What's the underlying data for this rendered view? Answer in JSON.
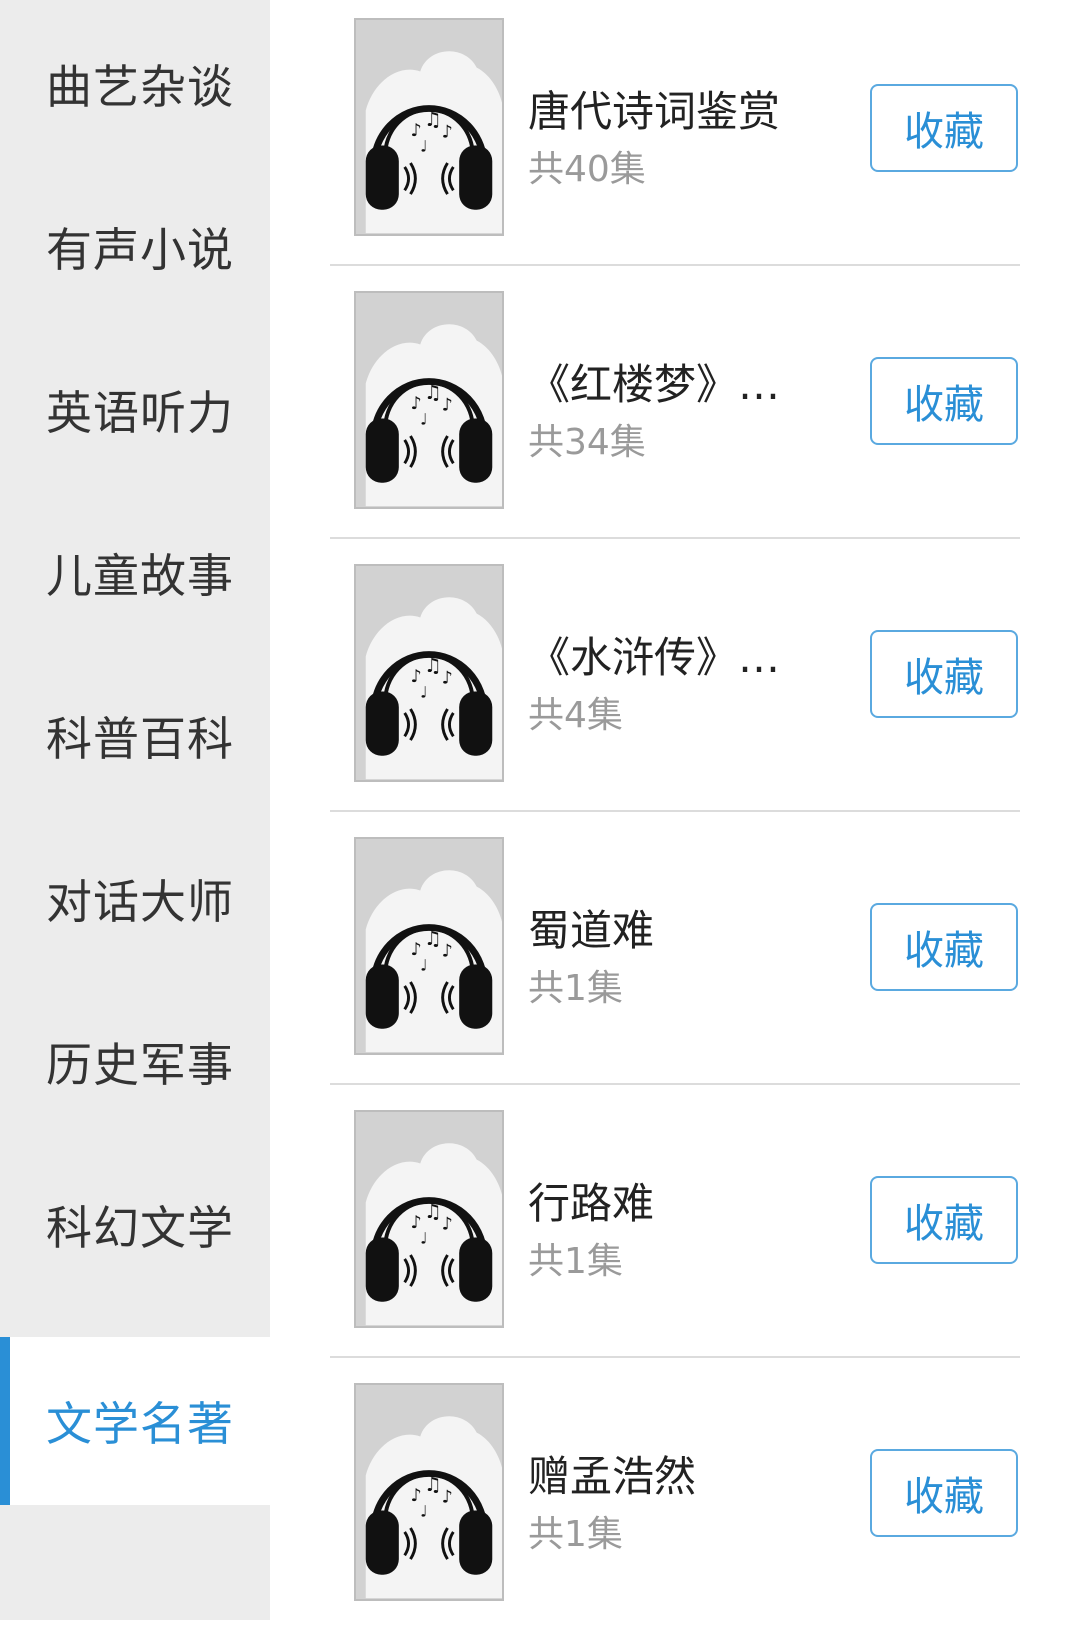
{
  "sidebar": {
    "categories": [
      {
        "label": "曲艺杂谈",
        "active": false
      },
      {
        "label": "有声小说",
        "active": false
      },
      {
        "label": "英语听力",
        "active": false
      },
      {
        "label": "儿童故事",
        "active": false
      },
      {
        "label": "科普百科",
        "active": false
      },
      {
        "label": "对话大师",
        "active": false
      },
      {
        "label": "历史军事",
        "active": false
      },
      {
        "label": "科幻文学",
        "active": false
      },
      {
        "label": "文学名著",
        "active": true
      }
    ]
  },
  "list": {
    "items": [
      {
        "title": "唐代诗词鉴赏",
        "count": "共40集",
        "button": "收藏",
        "cover_icon": "headphones-music-icon"
      },
      {
        "title": "《红楼梦》…",
        "count": "共34集",
        "button": "收藏",
        "cover_icon": "headphones-music-icon"
      },
      {
        "title": "《水浒传》…",
        "count": "共4集",
        "button": "收藏",
        "cover_icon": "headphones-music-icon"
      },
      {
        "title": "蜀道难",
        "count": "共1集",
        "button": "收藏",
        "cover_icon": "headphones-music-icon"
      },
      {
        "title": "行路难",
        "count": "共1集",
        "button": "收藏",
        "cover_icon": "headphones-music-icon"
      },
      {
        "title": "赠孟浩然",
        "count": "共1集",
        "button": "收藏",
        "cover_icon": "headphones-music-icon"
      }
    ]
  },
  "colors": {
    "accent": "#2a8fd6",
    "sidebar_bg": "#ececec",
    "cover_bg": "#d2d2d2"
  }
}
